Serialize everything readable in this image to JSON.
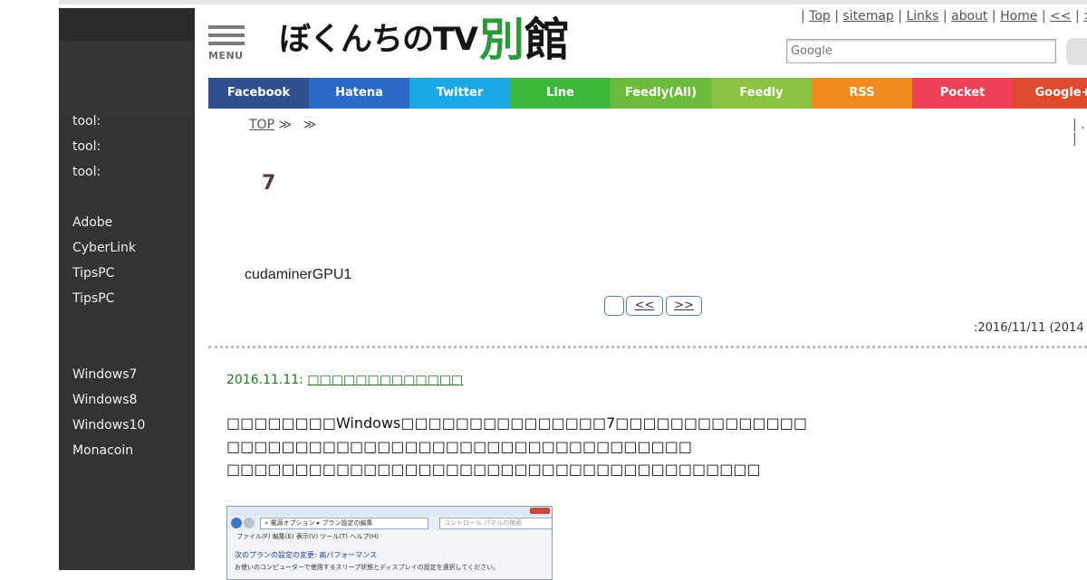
{
  "sidebar": {
    "items": [
      "tool:",
      "tool:",
      "tool:",
      "Adobe",
      "CyberLink",
      "TipsPC",
      "TipsPC",
      "Windows7",
      "Windows8",
      "Windows10",
      "Monacoin"
    ]
  },
  "header": {
    "menu_label": "MENU",
    "logo_main": "ぼくんちのTV",
    "logo_accent": "別",
    "logo_accent2": "館"
  },
  "toplinks": {
    "sep": "|",
    "items": [
      "Top",
      "sitemap",
      "Links",
      "about",
      "Home",
      "<<",
      ">"
    ]
  },
  "search": {
    "placeholder": "Google"
  },
  "social": {
    "buttons": [
      {
        "label": "Facebook",
        "color": "#2f4f8f"
      },
      {
        "label": "Hatena",
        "color": "#2a6bc8"
      },
      {
        "label": "Twitter",
        "color": "#19a9e6"
      },
      {
        "label": "Line",
        "color": "#3cb93c"
      },
      {
        "label": "Feedly(All)",
        "color": "#6cbb3c"
      },
      {
        "label": "Feedly",
        "color": "#8bc243"
      },
      {
        "label": "RSS",
        "color": "#f08a1c"
      },
      {
        "label": "Pocket",
        "color": "#ee4056"
      },
      {
        "label": "Google+",
        "color": "#dd4b2c"
      }
    ]
  },
  "breadcrumb": {
    "top": "TOP",
    "sep1": "≫",
    "sep2": "≫",
    "right": "| . |"
  },
  "post": {
    "title": "7",
    "summary": "cudaminerGPU1",
    "pager": {
      "first": "",
      "prev": "<<",
      "next": ">>"
    },
    "dates": ":2016/11/11   (2014"
  },
  "entry": {
    "date": "2016.11.11:",
    "date_title": "□□□□□□□□□□□□□",
    "lines": [
      "□□□□□□□□Windows□□□□□□□□□□□□□□□7□□□□□□□□□□□□□□",
      "□□□□□□□□□□□□□□□□□□□□□□□□□□□□□□□□□□",
      "□□□□□□□□□□□□□□□□□□□□□□□□□□□□□□□□□□□□□□□"
    ]
  },
  "screenshot": {
    "path": "« 電源オプション ▸ プラン設定の編集",
    "search": "コントロール パネルの検索",
    "menu": "ファイル(F)   編集(E)   表示(V)   ツール(T)   ヘルプ(H)",
    "heading": "次のプランの設定の変更: 高パフォーマンス",
    "text": "お使いのコンピューターで使用するスリープ状態とディスプレイの設定を選択してください。"
  }
}
